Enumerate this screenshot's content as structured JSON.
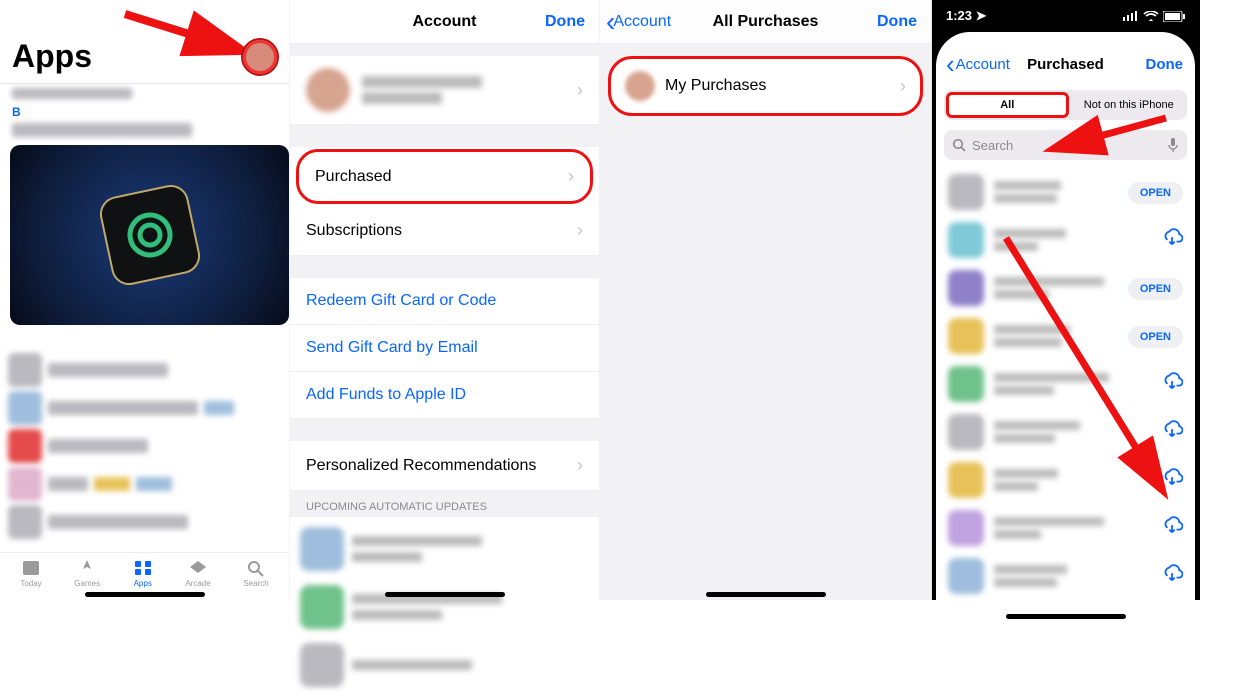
{
  "colors": {
    "ios_blue": "#0a66ff",
    "highlight_red": "#e11"
  },
  "arrows": [
    {
      "on_phone": 1,
      "from": "top-left",
      "to": "avatar-button"
    },
    {
      "on_phone": 4,
      "from": "segmented-all-option",
      "to": "cloud-download-icon"
    }
  ],
  "phone1": {
    "title": "Apps",
    "avatar_label": "Account",
    "tabs": [
      {
        "id": "today",
        "label": "Today"
      },
      {
        "id": "games",
        "label": "Games"
      },
      {
        "id": "apps",
        "label": "Apps",
        "active": true
      },
      {
        "id": "arcade",
        "label": "Arcade"
      },
      {
        "id": "search",
        "label": "Search"
      }
    ],
    "editorial_tag": "B"
  },
  "phone2": {
    "title": "Account",
    "done": "Done",
    "rows": {
      "purchased": "Purchased",
      "subscriptions": "Subscriptions",
      "redeem": "Redeem Gift Card or Code",
      "sendgc": "Send Gift Card by Email",
      "addfunds": "Add Funds to Apple ID",
      "personalized": "Personalized Recommendations"
    },
    "updates_header": "UPCOMING AUTOMATIC UPDATES"
  },
  "phone3": {
    "back": "Account",
    "title": "All Purchases",
    "done": "Done",
    "my_purchases": "My Purchases"
  },
  "phone4": {
    "status_time": "1:23",
    "back": "Account",
    "title": "Purchased",
    "done": "Done",
    "seg_all": "All",
    "seg_not": "Not on this iPhone",
    "search_placeholder": "Search",
    "open_label": "OPEN",
    "items": [
      {
        "action": "open"
      },
      {
        "action": "cloud"
      },
      {
        "action": "open"
      },
      {
        "action": "open"
      },
      {
        "action": "cloud"
      },
      {
        "action": "cloud"
      },
      {
        "action": "cloud"
      },
      {
        "action": "cloud"
      },
      {
        "action": "cloud"
      }
    ]
  }
}
